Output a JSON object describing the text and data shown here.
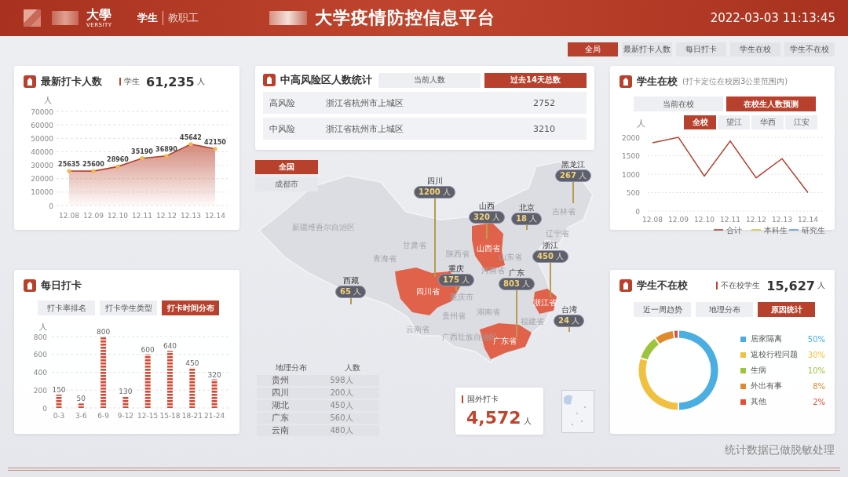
{
  "header": {
    "logo_text": "大學",
    "logo_subtext": "VERSITY",
    "user_tabs": [
      {
        "label": "学生",
        "selected": true
      },
      {
        "label": "教职工",
        "selected": false
      }
    ],
    "title": "大学疫情防控信息平台",
    "datetime": "2022-03-03 11:13:45"
  },
  "nav_tabs": [
    {
      "label": "全局",
      "selected": true
    },
    {
      "label": "最新打卡人数",
      "selected": false
    },
    {
      "label": "每日打卡",
      "selected": false
    },
    {
      "label": "学生在校",
      "selected": false
    },
    {
      "label": "学生不在校",
      "selected": false
    }
  ],
  "checkin_card": {
    "title": "最新打卡人数",
    "legend": "学生",
    "total": "61,235",
    "unit": "人",
    "chart_data": {
      "type": "area",
      "ylabel": "人",
      "categories": [
        "12.08",
        "12.09",
        "12.10",
        "12.11",
        "12.12",
        "12.13",
        "12.14"
      ],
      "values": [
        25635,
        25600,
        28960,
        35190,
        36890,
        45642,
        42150
      ],
      "ylim": [
        0,
        70000
      ],
      "yticks": [
        0,
        10000,
        20000,
        30000,
        40000,
        50000,
        60000,
        70000
      ],
      "grid": true,
      "data_labels": true
    }
  },
  "daily_card": {
    "title": "每日打卡",
    "tabs": [
      {
        "label": "打卡率排名",
        "selected": false
      },
      {
        "label": "打卡学生类型",
        "selected": false
      },
      {
        "label": "打卡时间分布",
        "selected": true
      }
    ],
    "chart_data": {
      "type": "bar",
      "ylabel": "人",
      "categories": [
        "0-3",
        "3-6",
        "6-9",
        "9-12",
        "12-15",
        "15-18",
        "18-21",
        "21-24"
      ],
      "values": [
        150,
        50,
        800,
        130,
        600,
        640,
        450,
        320
      ],
      "ylim": [
        0,
        800
      ],
      "yticks": [
        0,
        200,
        400,
        600,
        800
      ],
      "grid": true,
      "data_labels": true
    }
  },
  "risk_card": {
    "title": "中高风险区人数统计",
    "tabs": [
      {
        "label": "当前人数",
        "selected": false
      },
      {
        "label": "过去14天总数",
        "selected": true
      }
    ],
    "rows": [
      {
        "level": "高风险",
        "area": "浙江省杭州市上城区",
        "count": "2752"
      },
      {
        "level": "中风险",
        "area": "浙江省杭州市上城区",
        "count": "3210"
      }
    ]
  },
  "map": {
    "scope_buttons": [
      {
        "label": "全国",
        "selected": true
      },
      {
        "label": "成都市",
        "selected": false
      }
    ],
    "regions": [
      {
        "label": "新疆维吾尔自治区",
        "highlighted": false
      },
      {
        "label": "青海省",
        "highlighted": false
      },
      {
        "label": "甘肃省",
        "highlighted": false
      },
      {
        "label": "陕西省",
        "highlighted": false
      },
      {
        "label": "山西省",
        "highlighted": true
      },
      {
        "label": "河南省",
        "highlighted": false
      },
      {
        "label": "山东省",
        "highlighted": false
      },
      {
        "label": "辽宁省",
        "highlighted": false
      },
      {
        "label": "吉林省",
        "highlighted": false
      },
      {
        "label": "四川省",
        "highlighted": true
      },
      {
        "label": "重庆市",
        "highlighted": false
      },
      {
        "label": "湖南省",
        "highlighted": false
      },
      {
        "label": "贵州省",
        "highlighted": false
      },
      {
        "label": "云南省",
        "highlighted": false
      },
      {
        "label": "广西壮族自治区",
        "highlighted": false
      },
      {
        "label": "广东省",
        "highlighted": true
      },
      {
        "label": "福建省",
        "highlighted": false
      },
      {
        "label": "浙江省",
        "highlighted": true
      }
    ],
    "markers": [
      {
        "label": "四川",
        "value": "1200",
        "unit": "人"
      },
      {
        "label": "山西",
        "value": "320",
        "unit": "人"
      },
      {
        "label": "北京",
        "value": "18",
        "unit": "人"
      },
      {
        "label": "黑龙江",
        "value": "267",
        "unit": "人"
      },
      {
        "label": "浙江",
        "value": "450",
        "unit": "人"
      },
      {
        "label": "广东",
        "value": "803",
        "unit": "人"
      },
      {
        "label": "重庆",
        "value": "175",
        "unit": "人"
      },
      {
        "label": "西藏",
        "value": "65",
        "unit": "人"
      },
      {
        "label": "台湾",
        "value": "24",
        "unit": "人"
      }
    ],
    "geo_table": {
      "columns": [
        "地理分布",
        "人数"
      ],
      "rows": [
        [
          "贵州",
          "598人"
        ],
        [
          "四川",
          "200人"
        ],
        [
          "湖北",
          "450人"
        ],
        [
          "广东",
          "560人"
        ],
        [
          "云南",
          "480人"
        ]
      ]
    },
    "abroad": {
      "label": "国外打卡",
      "value": "4,572",
      "unit": "人"
    }
  },
  "campus_card": {
    "title": "学生在校",
    "note": "(打卡定位在校园3公里范围内)",
    "tabs": [
      {
        "label": "当前在校",
        "selected": false
      },
      {
        "label": "在校生人数预测",
        "selected": true
      }
    ],
    "campus_tabs": [
      {
        "label": "全校",
        "selected": true
      },
      {
        "label": "望江",
        "selected": false
      },
      {
        "label": "华西",
        "selected": false
      },
      {
        "label": "江安",
        "selected": false
      }
    ],
    "chart_data": {
      "type": "line",
      "ylabel": "人",
      "categories": [
        "12.08",
        "12.09",
        "12.10",
        "12.11",
        "12.12",
        "12.13",
        "12.14"
      ],
      "ylim": [
        0,
        2000
      ],
      "yticks": [
        0,
        500,
        1000,
        1500,
        2000
      ],
      "grid": true,
      "series": [
        {
          "name": "合计",
          "color": "#b5412f",
          "values": [
            1850,
            2000,
            950,
            1900,
            900,
            1420,
            500
          ]
        },
        {
          "name": "本科生",
          "color": "#e0c040",
          "values": [
            null,
            null,
            null,
            null,
            null,
            null,
            null
          ]
        },
        {
          "name": "研究生",
          "color": "#5b9bd5",
          "values": [
            null,
            null,
            null,
            null,
            null,
            null,
            null
          ]
        }
      ]
    }
  },
  "absent_card": {
    "title": "学生不在校",
    "legend": "不在校学生",
    "total": "15,627",
    "unit": "人",
    "tabs": [
      {
        "label": "近一周趋势",
        "selected": false
      },
      {
        "label": "地理分布",
        "selected": false
      },
      {
        "label": "原因统计",
        "selected": true
      }
    ],
    "chart_data": {
      "type": "donut",
      "categories": [
        "居家隔离",
        "返校行程问题",
        "生病",
        "外出有事",
        "其他"
      ],
      "values": [
        50,
        30,
        10,
        8,
        2
      ]
    },
    "legend_items": [
      {
        "percent": "50%",
        "color": "#4aaee0"
      },
      {
        "percent": "30%",
        "color": "#f0c040"
      },
      {
        "percent": "10%",
        "color": "#9cc43c"
      },
      {
        "percent": "8%",
        "color": "#e08a30"
      },
      {
        "percent": "2%",
        "color": "#e0503a"
      }
    ]
  },
  "footer_note": "统计数据已做脱敏处理"
}
